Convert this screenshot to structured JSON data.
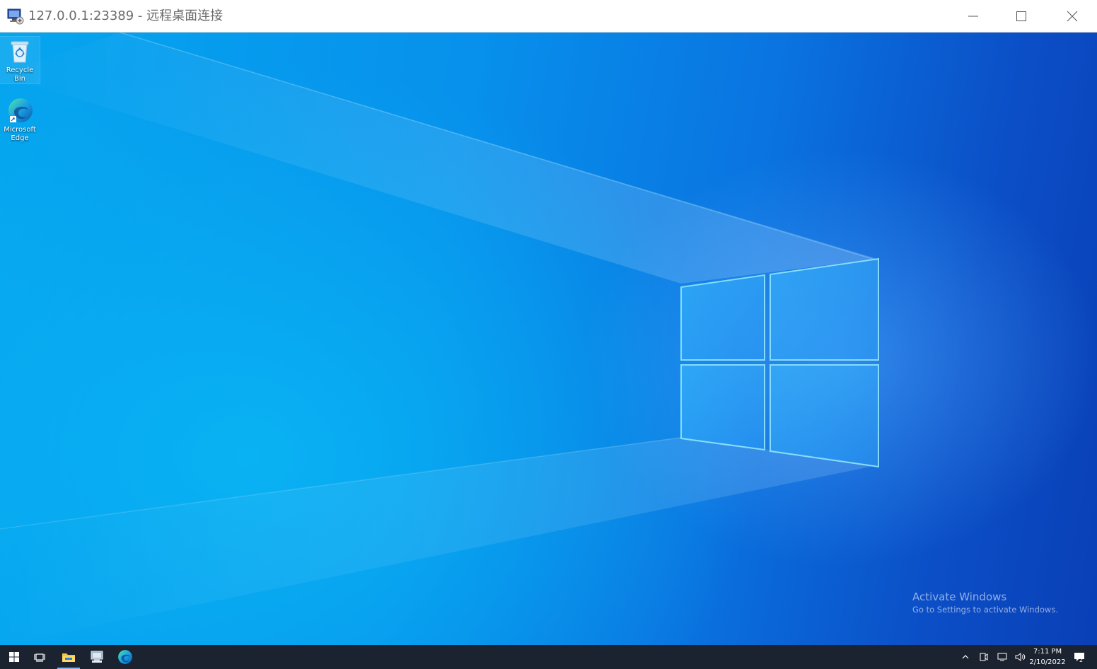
{
  "window": {
    "title": "127.0.0.1:23389 - 远程桌面连接",
    "controls": [
      "minimize",
      "maximize",
      "close"
    ]
  },
  "desktop": {
    "icons": [
      {
        "label": "Recycle Bin",
        "icon": "recycle-bin-icon",
        "selected": true
      },
      {
        "label": "Microsoft Edge",
        "icon": "edge-icon",
        "selected": false
      }
    ],
    "watermark": {
      "title": "Activate Windows",
      "subtitle": "Go to Settings to activate Windows."
    }
  },
  "taskbar": {
    "items": [
      {
        "name": "start",
        "icon": "windows-logo-icon"
      },
      {
        "name": "task-view",
        "icon": "task-view-icon"
      },
      {
        "name": "file-explorer",
        "icon": "folder-icon",
        "active": true
      },
      {
        "name": "remote-desktop",
        "icon": "remote-desktop-icon"
      },
      {
        "name": "microsoft-edge",
        "icon": "edge-icon"
      }
    ],
    "tray": {
      "icons": [
        "chevron-up-icon",
        "meet-now-icon",
        "network-icon",
        "volume-icon"
      ],
      "time": "7:11 PM",
      "date": "2/10/2022",
      "notification_count": "2"
    }
  },
  "colors": {
    "taskbar": "#1c2330",
    "titlebar": "#ffffff",
    "wallpaper_blue": "#0a74e0",
    "active_indicator": "#7fb4ef"
  }
}
